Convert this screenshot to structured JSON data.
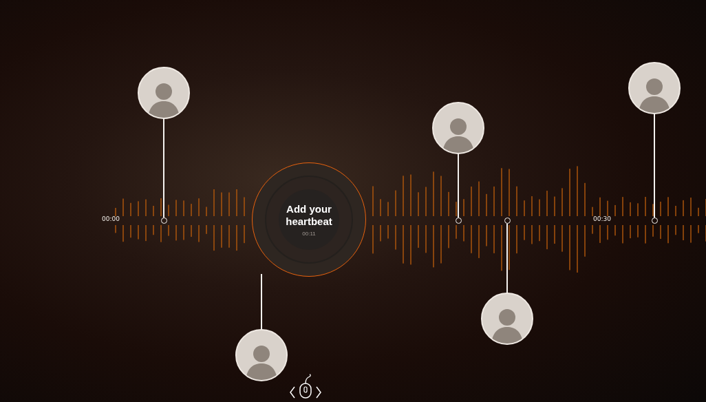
{
  "timeline": {
    "start_label": "00:00",
    "end_label": "00:30"
  },
  "record": {
    "title": "Add your heartbeat",
    "time": "00:11"
  },
  "pins": [
    {
      "kind": "above"
    },
    {
      "kind": "below"
    },
    {
      "kind": "above"
    },
    {
      "kind": "below"
    },
    {
      "kind": "above"
    }
  ]
}
